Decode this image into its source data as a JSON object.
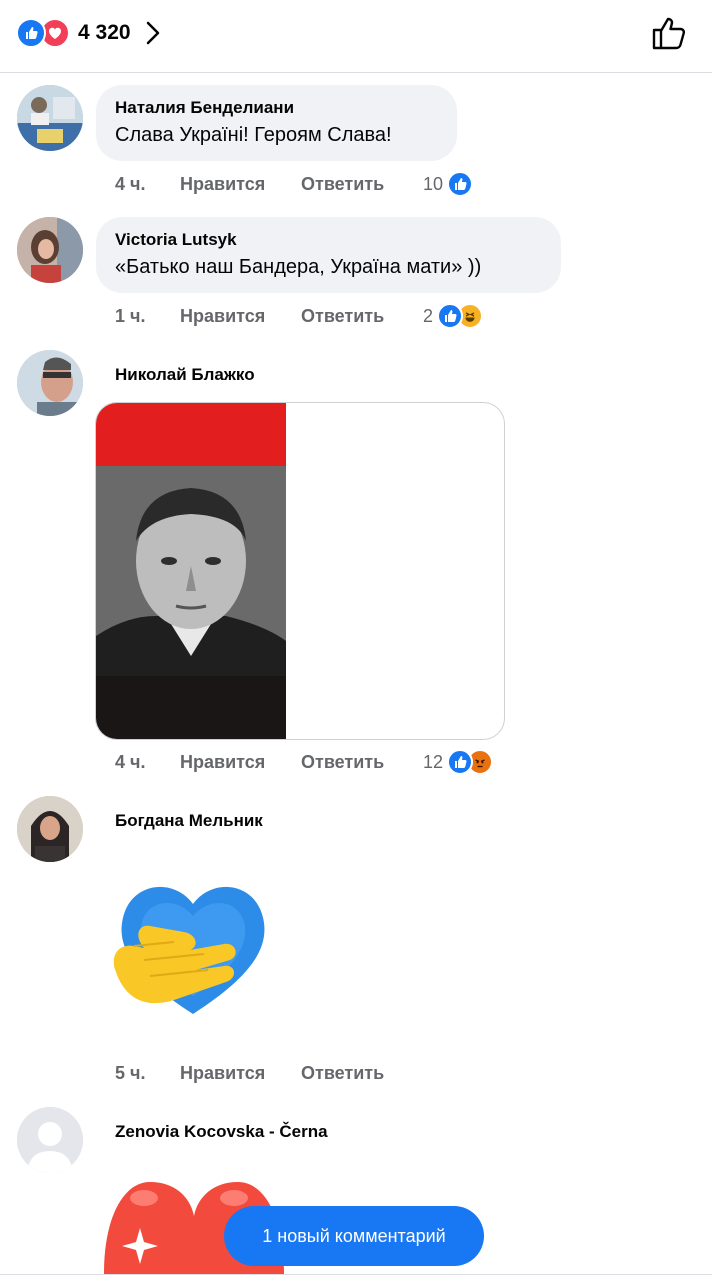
{
  "header": {
    "reaction_icons": [
      "like-icon",
      "love-icon"
    ],
    "reaction_count": "4 320",
    "chevron": "chevron-right-icon",
    "like_icon": "thumbs-up-outline-icon"
  },
  "comments": [
    {
      "author": "Наталия Бенделиани",
      "text": "Слава Україні! Героям Слава!",
      "time": "4 ч.",
      "like_label": "Нравится",
      "reply_label": "Ответить",
      "reaction_count": "10",
      "reactions": [
        "like"
      ]
    },
    {
      "author": "Victoria Lutsyk",
      "text": "«Батько наш Бандера, Україна мати» ))",
      "time": "1 ч.",
      "like_label": "Нравится",
      "reply_label": "Ответить",
      "reaction_count": "2",
      "reactions": [
        "like",
        "haha"
      ]
    },
    {
      "author": "Николай Блажко",
      "attachment": "photo on red-and-black flag",
      "time": "4 ч.",
      "like_label": "Нравится",
      "reply_label": "Ответить",
      "reaction_count": "12",
      "reactions": [
        "like",
        "angry"
      ]
    },
    {
      "author": "Богдана Мельник",
      "sticker": "hand-on-heart-sticker",
      "time": "5 ч.",
      "like_label": "Нравится",
      "reply_label": "Ответить"
    },
    {
      "author": "Zenovia Kocovska - Černa",
      "sticker": "red-hearts-sticker"
    }
  ],
  "new_comments_button": "1 новый комментарий",
  "colors": {
    "accent": "#1877f2",
    "love": "#f33e58",
    "bubble": "#f0f2f5",
    "meta_text": "#65676b"
  }
}
